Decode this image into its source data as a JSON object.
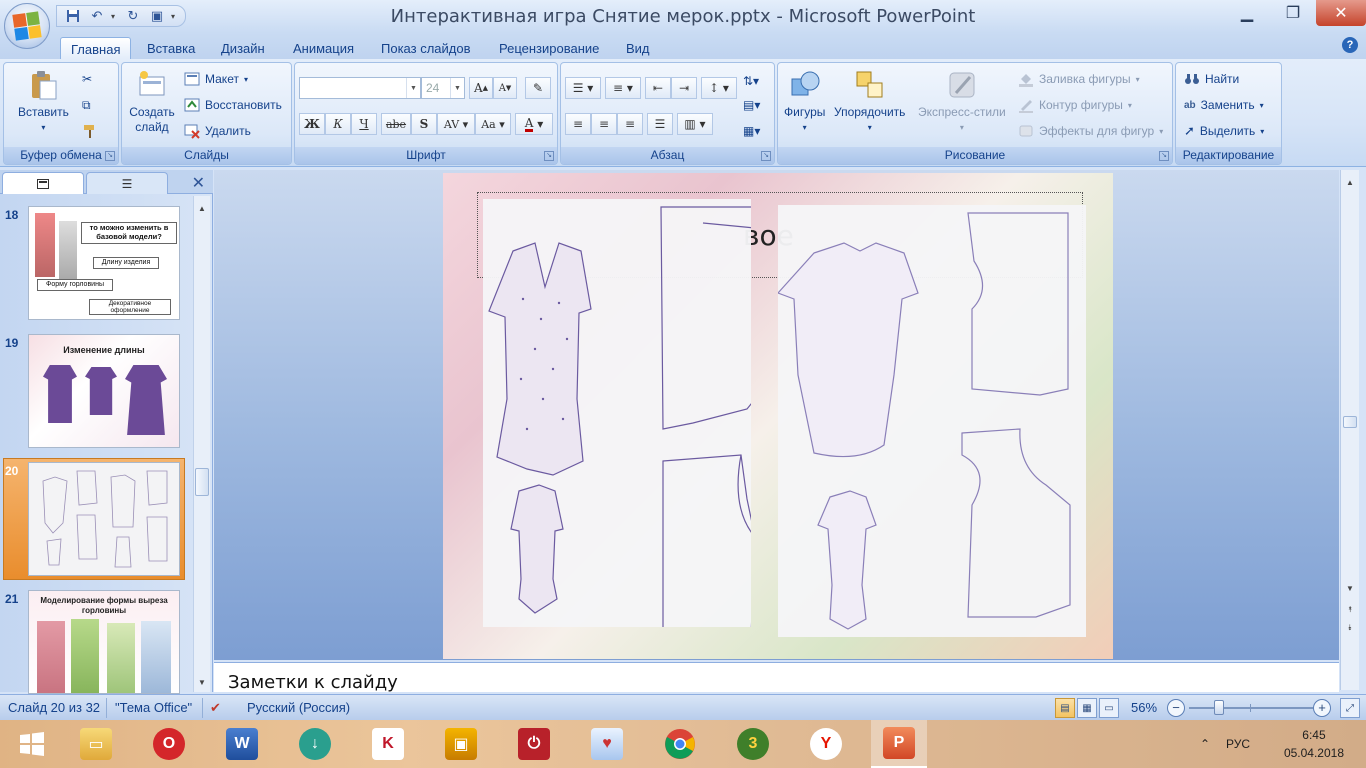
{
  "window": {
    "title": "Интерактивная игра Снятие мерок.pptx - Microsoft PowerPoint"
  },
  "tabs": [
    "Главная",
    "Вставка",
    "Дизайн",
    "Анимация",
    "Показ слайдов",
    "Рецензирование",
    "Вид"
  ],
  "ribbon": {
    "clipboard": {
      "label": "Буфер обмена",
      "paste": "Вставить"
    },
    "slides": {
      "label": "Слайды",
      "new_slide": "Создать слайд",
      "layout": "Макет",
      "reset": "Восстановить",
      "delete": "Удалить"
    },
    "font": {
      "label": "Шрифт",
      "font_name": "",
      "font_size": "24",
      "bold": "Ж",
      "italic": "К",
      "underline": "Ч",
      "strike": "abe",
      "shadow": "S",
      "spacing": "AV",
      "case": "Aa"
    },
    "paragraph": {
      "label": "Абзац"
    },
    "drawing": {
      "label": "Рисование",
      "shapes": "Фигуры",
      "arrange": "Упорядочить",
      "quick_styles": "Экспресс-стили",
      "fill": "Заливка фигуры",
      "outline": "Контур фигуры",
      "effects": "Эффекты для фигур"
    },
    "editing": {
      "label": "Редактирование",
      "find": "Найти",
      "replace": "Заменить",
      "select": "Выделить"
    }
  },
  "slides_panel": {
    "thumbnails": [
      {
        "num": "18",
        "texts": [
          "то можно изменить в базовой модели?",
          "Длину изделия",
          "Форму горловины",
          "Декоративное оформление"
        ]
      },
      {
        "num": "19",
        "texts": [
          "Изменение длины"
        ]
      },
      {
        "num": "20",
        "texts": []
      },
      {
        "num": "21",
        "texts": [
          "Моделирование формы выреза горловины"
        ]
      }
    ]
  },
  "slide": {
    "title_fragment": "вое"
  },
  "notes": {
    "placeholder": "Заметки к слайду"
  },
  "status": {
    "slide_counter": "Слайд 20 из 32",
    "theme": "\"Тема Office\"",
    "language": "Русский (Россия)",
    "zoom": "56%"
  },
  "taskbar": {
    "language": "РУС",
    "time": "6:45",
    "date": "05.04.2018"
  },
  "colors": {
    "accent": "#15428b",
    "ribbon": "#dce8f8",
    "selection": "#e98d2d"
  }
}
